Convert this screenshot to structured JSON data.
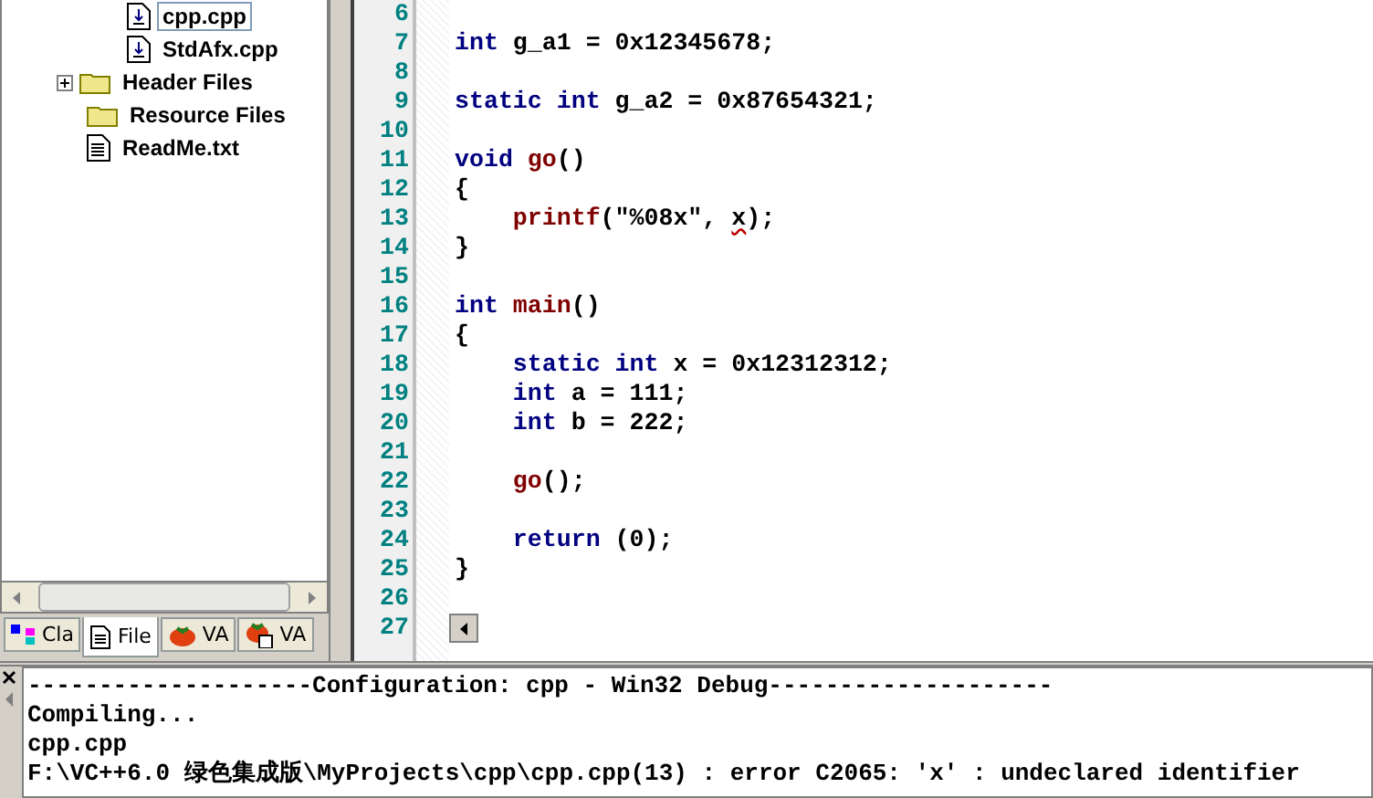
{
  "workspace": {
    "source_files": [
      {
        "label": "cpp.cpp",
        "kind": "source",
        "selected": true
      },
      {
        "label": "StdAfx.cpp",
        "kind": "source",
        "selected": false
      }
    ],
    "items": [
      {
        "label": "Header Files",
        "kind": "folder",
        "expanded": false
      },
      {
        "label": "Resource Files",
        "kind": "folder"
      },
      {
        "label": "ReadMe.txt",
        "kind": "text"
      }
    ],
    "tabs": [
      {
        "label": "Cla",
        "kind": "class",
        "selected": false
      },
      {
        "label": "File",
        "kind": "file",
        "selected": true
      },
      {
        "label": "VA",
        "kind": "tomato",
        "selected": false
      },
      {
        "label": "VA",
        "kind": "tomato-doc",
        "selected": false
      }
    ]
  },
  "editor": {
    "lines": [
      {
        "number": "6"
      },
      {
        "number": "7",
        "tokens": [
          {
            "kind": "keyword",
            "text": "int"
          },
          {
            "kind": "plain",
            "text": " g_a1 = 0x12345678;"
          }
        ]
      },
      {
        "number": "8"
      },
      {
        "number": "9",
        "tokens": [
          {
            "kind": "keyword",
            "text": "static int"
          },
          {
            "kind": "plain",
            "text": " g_a2 = 0x87654321;"
          }
        ]
      },
      {
        "number": "10"
      },
      {
        "number": "11",
        "tokens": [
          {
            "kind": "keyword",
            "text": "void "
          },
          {
            "kind": "func",
            "text": "go"
          },
          {
            "kind": "plain",
            "text": "()"
          }
        ]
      },
      {
        "number": "12",
        "tokens": [
          {
            "kind": "plain",
            "text": "{"
          }
        ]
      },
      {
        "number": "13",
        "tokens": [
          {
            "kind": "func",
            "text": "    printf"
          },
          {
            "kind": "plain",
            "text": "(\"%08x\", "
          },
          {
            "kind": "error",
            "text": "x"
          },
          {
            "kind": "plain",
            "text": ");"
          }
        ]
      },
      {
        "number": "14",
        "tokens": [
          {
            "kind": "plain",
            "text": "}"
          }
        ]
      },
      {
        "number": "15"
      },
      {
        "number": "16",
        "tokens": [
          {
            "kind": "keyword",
            "text": "int "
          },
          {
            "kind": "func",
            "text": "main"
          },
          {
            "kind": "plain",
            "text": "()"
          }
        ]
      },
      {
        "number": "17",
        "tokens": [
          {
            "kind": "plain",
            "text": "{"
          }
        ]
      },
      {
        "number": "18",
        "tokens": [
          {
            "kind": "keyword",
            "text": "    static int"
          },
          {
            "kind": "plain",
            "text": " x = 0x12312312;"
          }
        ]
      },
      {
        "number": "19",
        "tokens": [
          {
            "kind": "keyword",
            "text": "    int"
          },
          {
            "kind": "plain",
            "text": " a = 111;"
          }
        ]
      },
      {
        "number": "20",
        "tokens": [
          {
            "kind": "keyword",
            "text": "    int"
          },
          {
            "kind": "plain",
            "text": " b = 222;"
          }
        ]
      },
      {
        "number": "21"
      },
      {
        "number": "22",
        "tokens": [
          {
            "kind": "func",
            "text": "    go"
          },
          {
            "kind": "plain",
            "text": "();"
          }
        ]
      },
      {
        "number": "23"
      },
      {
        "number": "24",
        "tokens": [
          {
            "kind": "keyword",
            "text": "    return"
          },
          {
            "kind": "plain",
            "text": " (0);"
          }
        ]
      },
      {
        "number": "25",
        "tokens": [
          {
            "kind": "plain",
            "text": "}"
          }
        ]
      },
      {
        "number": "26"
      },
      {
        "number": "27"
      }
    ]
  },
  "output": {
    "lines": [
      "--------------------Configuration: cpp - Win32 Debug--------------------",
      "Compiling...",
      "cpp.cpp",
      "F:\\VC++6.0 绿色集成版\\MyProjects\\cpp\\cpp.cpp(13) : error C2065: 'x' : undeclared identifier"
    ]
  }
}
